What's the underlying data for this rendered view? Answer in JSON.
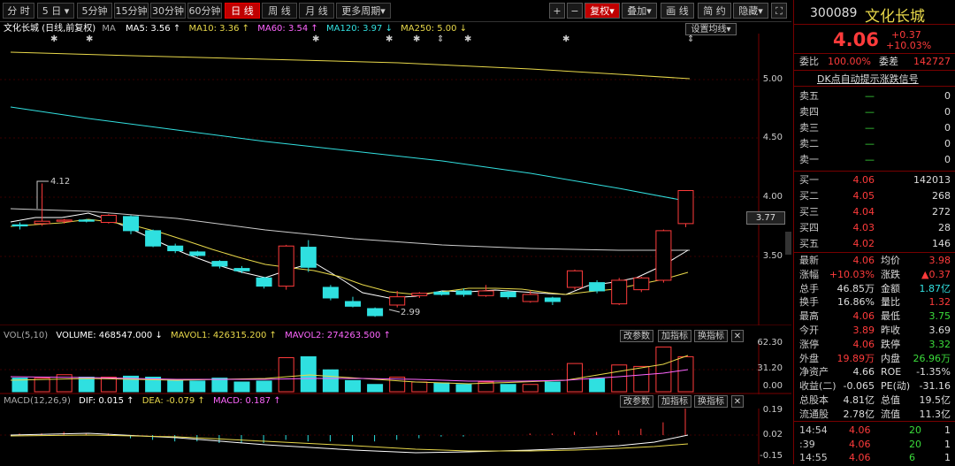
{
  "toolbar": {
    "periods": [
      "分 时",
      "5 日",
      "5分钟",
      "15分钟",
      "30分钟",
      "60分钟",
      "日 线",
      "周 线",
      "月 线",
      "更多周期"
    ],
    "active_index": 6,
    "dropdown_marker": "▾",
    "zoom_in": "+",
    "zoom_out": "−",
    "adjust": "复权",
    "overlay": "叠加",
    "draw": "画 线",
    "simplify": "简 约",
    "hide": "隐藏",
    "expand_icon": "⛶"
  },
  "chart_title": "文化长城",
  "chart_mode": "(日线,前复权)",
  "ma_label": "MA",
  "ma": [
    {
      "label": "MA5: 3.56",
      "arrow": "↑",
      "color": "#ffffff"
    },
    {
      "label": "MA10: 3.36",
      "arrow": "↑",
      "color": "#e8d84a"
    },
    {
      "label": "MA60: 3.54",
      "arrow": "↑",
      "color": "#ff66ff"
    },
    {
      "label": "MA120: 3.97",
      "arrow": "↓",
      "color": "#32e0e0"
    },
    {
      "label": "MA250: 5.00",
      "arrow": "↓",
      "color": "#e8d84a"
    }
  ],
  "set_ma_btn": "设置均线",
  "y_axis_main": [
    "5.00",
    "4.50",
    "4.00",
    "3.50"
  ],
  "current_price_tag": "3.77",
  "annotations": {
    "high": "4.12",
    "low": "2.99"
  },
  "vol_panel": {
    "name": "VOL(5,10)",
    "volume": "VOLUME: 468547.000",
    "volume_arrow": "↓",
    "mavol1": "MAVOL1: 426315.200",
    "mavol1_arrow": "↑",
    "mavol2": "MAVOL2: 274263.500",
    "mavol2_arrow": "↑",
    "y_labels": [
      "62.30",
      "31.20",
      "0.00"
    ],
    "btn_modify": "改参数",
    "btn_add": "加指标",
    "btn_switch": "换指标",
    "btn_close": "✕"
  },
  "macd_panel": {
    "name": "MACD(12,26,9)",
    "dif": "DIF: 0.015",
    "dif_arrow": "↑",
    "dea": "DEA: -0.079",
    "dea_arrow": "↑",
    "macd": "MACD: 0.187",
    "macd_arrow": "↑",
    "y_labels": [
      "0.19",
      "0.02",
      "-0.15"
    ],
    "btn_modify": "改参数",
    "btn_add": "加指标",
    "btn_switch": "换指标",
    "btn_close": "✕"
  },
  "stock": {
    "code": "300089",
    "name": "文化长城",
    "price": "4.06",
    "change": "+0.37",
    "change_pct": "+10.03%",
    "weibi_label": "委比",
    "weibi": "100.00%",
    "weicha_label": "委差",
    "weicha": "142727",
    "dk_link": "DK点自动提示涨跌信号"
  },
  "asks": [
    {
      "label": "卖五",
      "price": "—",
      "vol": "0"
    },
    {
      "label": "卖四",
      "price": "—",
      "vol": "0"
    },
    {
      "label": "卖三",
      "price": "—",
      "vol": "0"
    },
    {
      "label": "卖二",
      "price": "—",
      "vol": "0"
    },
    {
      "label": "卖一",
      "price": "—",
      "vol": "0"
    }
  ],
  "bids": [
    {
      "label": "买一",
      "price": "4.06",
      "vol": "142013"
    },
    {
      "label": "买二",
      "price": "4.05",
      "vol": "268"
    },
    {
      "label": "买三",
      "price": "4.04",
      "vol": "272"
    },
    {
      "label": "买四",
      "price": "4.03",
      "vol": "28"
    },
    {
      "label": "买五",
      "price": "4.02",
      "vol": "146"
    }
  ],
  "stats": [
    {
      "l1": "最新",
      "v1": "4.06",
      "c1": "red",
      "l2": "均价",
      "v2": "3.98",
      "c2": "red"
    },
    {
      "l1": "涨幅",
      "v1": "+10.03%",
      "c1": "red",
      "l2": "涨跌",
      "v2": "▲0.37",
      "c2": "red"
    },
    {
      "l1": "总手",
      "v1": "46.85万",
      "c1": "white",
      "l2": "金额",
      "v2": "1.87亿",
      "c2": "cyan"
    },
    {
      "l1": "换手",
      "v1": "16.86%",
      "c1": "white",
      "l2": "量比",
      "v2": "1.32",
      "c2": "red"
    },
    {
      "l1": "最高",
      "v1": "4.06",
      "c1": "red",
      "l2": "最低",
      "v2": "3.75",
      "c2": "green"
    },
    {
      "l1": "今开",
      "v1": "3.89",
      "c1": "red",
      "l2": "昨收",
      "v2": "3.69",
      "c2": "white"
    },
    {
      "l1": "涨停",
      "v1": "4.06",
      "c1": "red",
      "l2": "跌停",
      "v2": "3.32",
      "c2": "green"
    },
    {
      "l1": "外盘",
      "v1": "19.89万",
      "c1": "red",
      "l2": "内盘",
      "v2": "26.96万",
      "c2": "green"
    },
    {
      "l1": "净资产",
      "v1": "4.66",
      "c1": "white",
      "l2": "ROE",
      "v2": "-1.35%",
      "c2": "white"
    },
    {
      "l1": "收益(二)",
      "v1": "-0.065",
      "c1": "white",
      "l2": "PE(动)",
      "v2": "-31.16",
      "c2": "white"
    },
    {
      "l1": "总股本",
      "v1": "4.81亿",
      "c1": "white",
      "l2": "总值",
      "v2": "19.5亿",
      "c2": "white"
    },
    {
      "l1": "流通股",
      "v1": "2.78亿",
      "c1": "white",
      "l2": "流值",
      "v2": "11.3亿",
      "c2": "white"
    }
  ],
  "ticks": [
    {
      "time": "14:54",
      "price": "4.06",
      "vol": "20",
      "n": "1"
    },
    {
      "time": ":39",
      "price": "4.06",
      "vol": "20",
      "n": "1"
    },
    {
      "time": "14:55",
      "price": "4.06",
      "vol": "6",
      "n": "1"
    }
  ]
}
